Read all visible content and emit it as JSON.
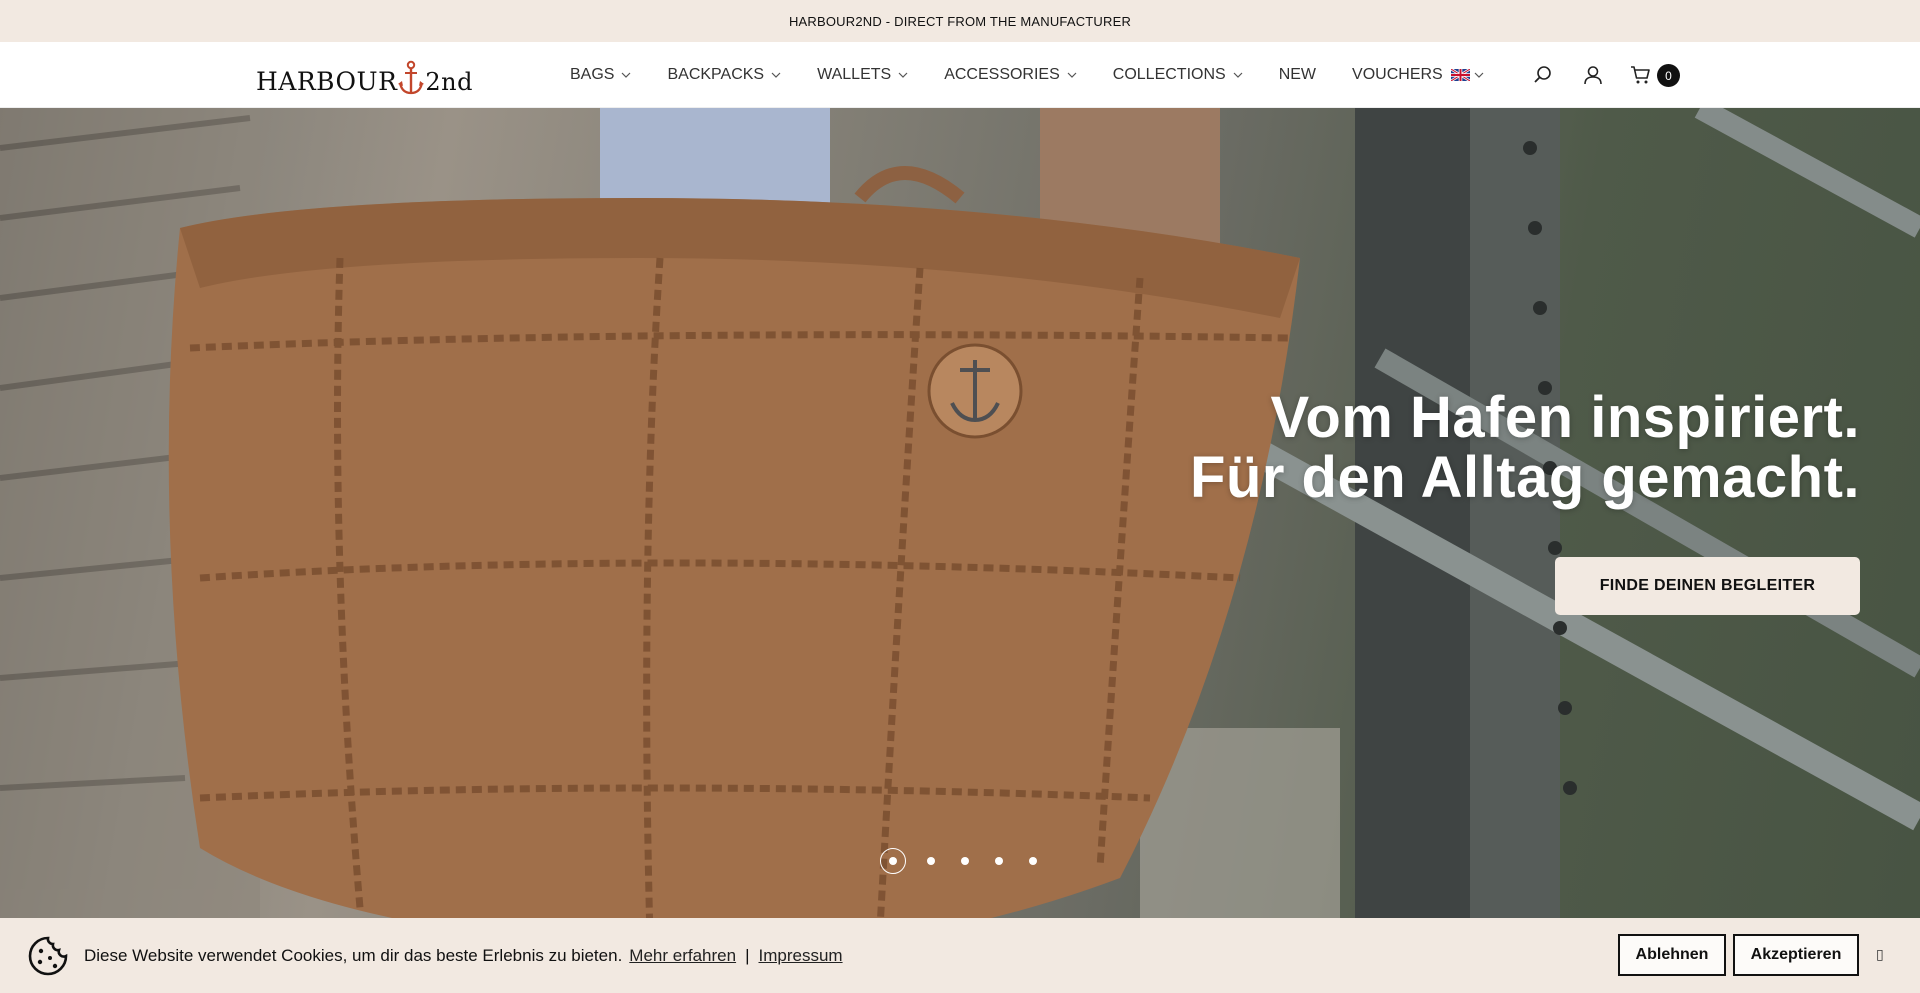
{
  "announcement": "HARBOUR2ND - DIRECT FROM THE MANUFACTURER",
  "logo": {
    "part_a": "HARBOUR",
    "part_b": "2nd"
  },
  "nav": [
    {
      "label": "BAGS",
      "dropdown": true
    },
    {
      "label": "BACKPACKS",
      "dropdown": true
    },
    {
      "label": "WALLETS",
      "dropdown": true
    },
    {
      "label": "ACCESSORIES",
      "dropdown": true
    },
    {
      "label": "COLLECTIONS",
      "dropdown": true
    },
    {
      "label": "NEW",
      "dropdown": false
    },
    {
      "label": "VOUCHERS",
      "dropdown": false
    }
  ],
  "header_icons": {
    "language": "uk-flag-icon",
    "search": "search-icon",
    "account": "user-icon",
    "cart": "cart-icon"
  },
  "cart": {
    "count": "0"
  },
  "hero": {
    "title_line1": "Vom Hafen inspiriert.",
    "title_line2": "Für den Alltag gemacht.",
    "cta_label": "FINDE DEINEN BEGLEITER",
    "slides": 5,
    "active_slide": 1
  },
  "cookie": {
    "text": "Diese Website verwendet Cookies, um dir das beste Erlebnis zu bieten.",
    "learn_more": "Mehr erfahren",
    "separator": "|",
    "imprint": "Impressum",
    "decline": "Ablehnen",
    "accept": "Akzeptieren",
    "close": "▯"
  },
  "colors": {
    "cream": "#f2e9e1",
    "logo_anchor": "#c2462b",
    "text": "#111111"
  }
}
